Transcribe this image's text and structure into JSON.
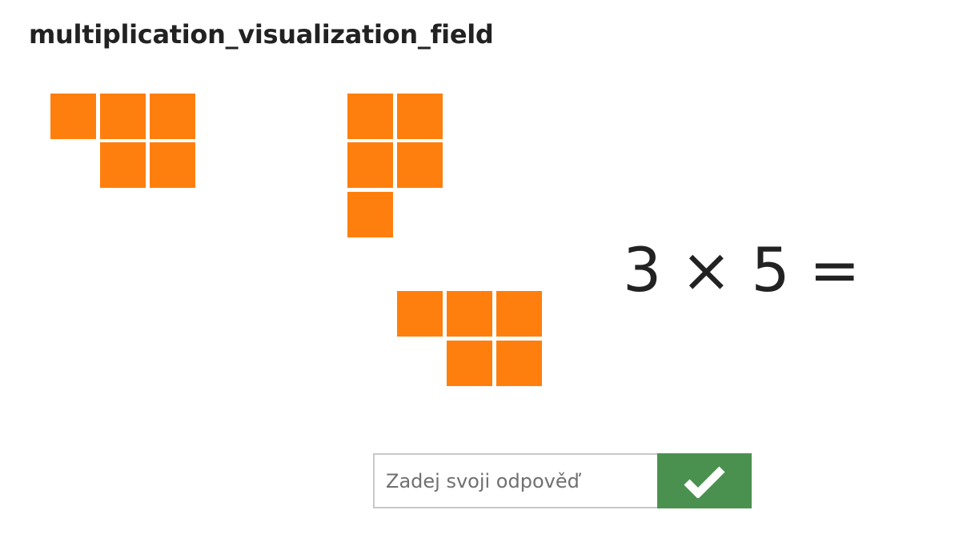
{
  "page": {
    "title": "multiplication_visualization_field"
  },
  "exercise": {
    "groups": 3,
    "items_per_group": 5,
    "tile_color": "#ff7f0e",
    "equation": "3 × 5 ="
  },
  "answer": {
    "placeholder": "Zadej svoji odpověď",
    "value": "",
    "submit_icon": "checkmark-icon",
    "submit_color": "#4a9150"
  }
}
